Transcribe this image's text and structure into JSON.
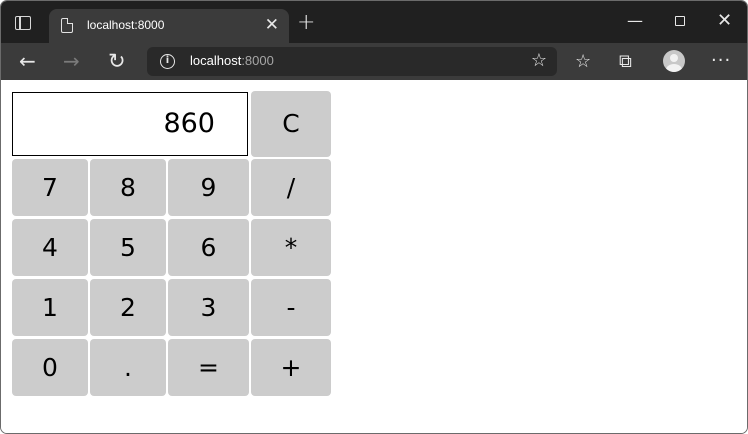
{
  "browser": {
    "tab_title": "localhost:8000",
    "new_tab_label": "+",
    "address": {
      "host": "localhost",
      "port": ":8000"
    },
    "icons": {
      "tab_actions": "tab-actions-icon",
      "page": "page-icon",
      "close_tab": "close-icon",
      "minimize": "minimize-icon",
      "maximize": "maximize-icon",
      "close_window": "close-icon",
      "back": "back-arrow-icon",
      "forward": "forward-arrow-icon",
      "refresh": "refresh-icon",
      "info": "info-icon",
      "add_favorite": "star-plus-icon",
      "favorites": "favorites-icon",
      "collections": "collections-icon",
      "profile": "avatar-icon",
      "more": "more-icon"
    },
    "glyphs": {
      "close_tab": "✕",
      "minimize": "—",
      "close_window": "✕",
      "back": "←",
      "forward": "→",
      "refresh": "↻",
      "info": "i",
      "add_favorite": "☆",
      "favorites": "☆",
      "collections": "⧉",
      "more": "···"
    }
  },
  "calculator": {
    "display": "860",
    "keys": {
      "clear": "C",
      "k7": "7",
      "k8": "8",
      "k9": "9",
      "divide": "/",
      "k4": "4",
      "k5": "5",
      "k6": "6",
      "multiply": "*",
      "k1": "1",
      "k2": "2",
      "k3": "3",
      "subtract": "-",
      "k0": "0",
      "decimal": ".",
      "equals": "=",
      "add": "+"
    }
  },
  "colors": {
    "key_background": "#cccccc",
    "titlebar": "#202020",
    "toolbar": "#3b3b3b"
  }
}
